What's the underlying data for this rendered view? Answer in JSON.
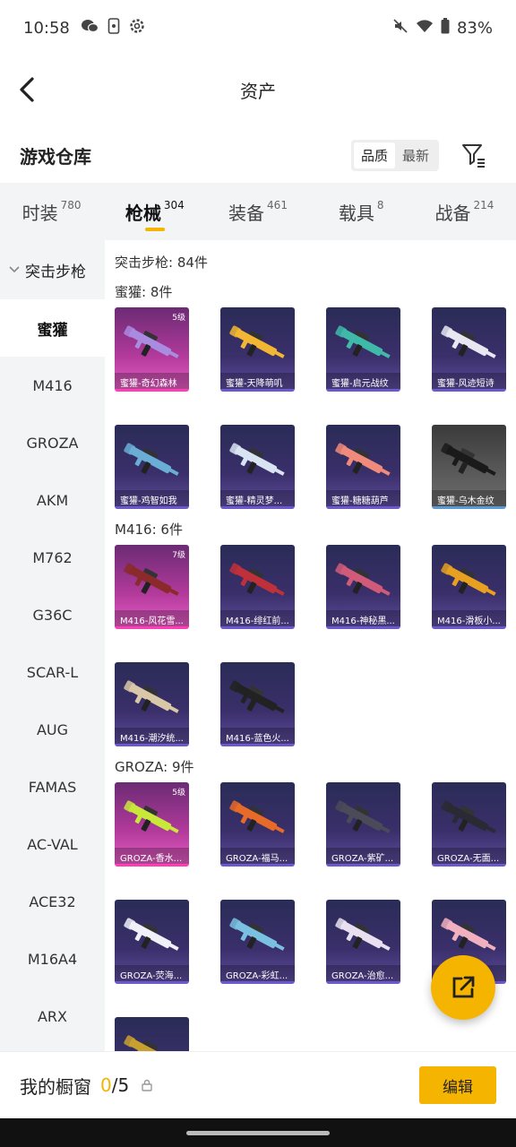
{
  "status": {
    "time": "10:58",
    "battery": "83%",
    "icons": [
      "wechat-icon",
      "phone-icon",
      "settings-icon"
    ],
    "right_icons": [
      "mute-icon",
      "wifi-icon",
      "battery-icon"
    ]
  },
  "header": {
    "title": "资产"
  },
  "subheader": {
    "title": "游戏仓库",
    "sort_options": [
      "品质",
      "最新"
    ]
  },
  "tabs": [
    {
      "label": "时装",
      "count": "780"
    },
    {
      "label": "枪械",
      "count": "304"
    },
    {
      "label": "装备",
      "count": "461"
    },
    {
      "label": "载具",
      "count": "8"
    },
    {
      "label": "战备",
      "count": "214"
    }
  ],
  "sidebar": {
    "group": "突击步枪",
    "items": [
      "蜜獾",
      "M416",
      "GROZA",
      "AKM",
      "M762",
      "G36C",
      "SCAR-L",
      "AUG",
      "FAMAS",
      "AC-VAL",
      "ACE32",
      "M16A4",
      "ARX"
    ]
  },
  "content": {
    "category_title": "突击步枪: 84件",
    "sections": [
      {
        "title": "蜜獾: 8件",
        "items": [
          {
            "name": "蜜獾-奇幻森林",
            "level": "5级",
            "style": "pink",
            "color": "#a98be0"
          },
          {
            "name": "蜜獾-天降萌叽",
            "level": "",
            "style": "",
            "color": "#f2b632"
          },
          {
            "name": "蜜獾-启元战纹",
            "level": "",
            "style": "",
            "color": "#3fb9a8"
          },
          {
            "name": "蜜獾-风迹短诗",
            "level": "",
            "style": "",
            "color": "#e8e6f0"
          },
          {
            "name": "蜜獾-鸡智如我",
            "level": "",
            "style": "",
            "color": "#6aaed6"
          },
          {
            "name": "蜜獾-精灵梦...",
            "level": "",
            "style": "",
            "color": "#d9e4f2"
          },
          {
            "name": "蜜獾-糖糖葫芦",
            "level": "",
            "style": "",
            "color": "#f08a7a"
          },
          {
            "name": "蜜獾-乌木金纹",
            "level": "",
            "style": "gray",
            "color": "#1a1a1a"
          }
        ]
      },
      {
        "title": "M416: 6件",
        "items": [
          {
            "name": "M416-风花雪...",
            "level": "7级",
            "style": "pink",
            "color": "#8a2a2a"
          },
          {
            "name": "M416-绯红前...",
            "level": "",
            "style": "",
            "color": "#c0303a"
          },
          {
            "name": "M416-神秘黑...",
            "level": "",
            "style": "",
            "color": "#d05a7a"
          },
          {
            "name": "M416-滑板小...",
            "level": "",
            "style": "",
            "color": "#e8a020"
          },
          {
            "name": "M416-潮汐统...",
            "level": "",
            "style": "",
            "color": "#d8c8a8"
          },
          {
            "name": "M416-蓝色火...",
            "level": "",
            "style": "",
            "color": "#222222"
          }
        ]
      },
      {
        "title": "GROZA: 9件",
        "items": [
          {
            "name": "GROZA-香水...",
            "level": "5级",
            "style": "pink",
            "color": "#c8e83a"
          },
          {
            "name": "GROZA-福马...",
            "level": "",
            "style": "",
            "color": "#e86a28"
          },
          {
            "name": "GROZA-紫矿...",
            "level": "",
            "style": "",
            "color": "#4a4a58"
          },
          {
            "name": "GROZA-无面...",
            "level": "",
            "style": "",
            "color": "#2a2a34"
          },
          {
            "name": "GROZA-荧海...",
            "level": "",
            "style": "",
            "color": "#f0f0f8"
          },
          {
            "name": "GROZA-彩虹...",
            "level": "",
            "style": "",
            "color": "#7ac0e0"
          },
          {
            "name": "GROZA-治愈...",
            "level": "",
            "style": "",
            "color": "#e8e0f0"
          },
          {
            "name": "GROZA-...花",
            "level": "",
            "style": "",
            "color": "#f0b0c0"
          },
          {
            "name": "",
            "level": "",
            "style": "",
            "color": "#c8a030"
          }
        ]
      }
    ]
  },
  "bottom": {
    "label": "我的橱窗",
    "count": "0",
    "total": "/5",
    "edit_label": "编辑"
  },
  "colors": {
    "accent": "#f5b400"
  }
}
